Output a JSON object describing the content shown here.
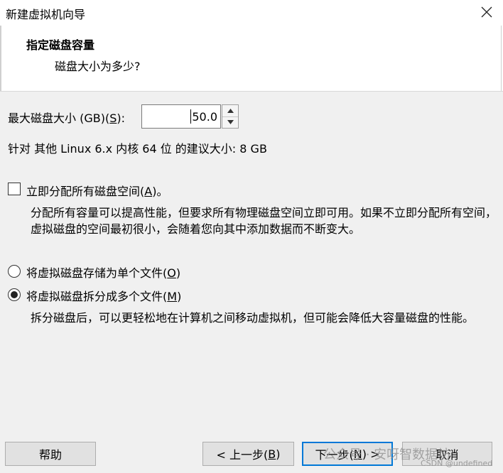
{
  "window": {
    "title": "新建虚拟机向导"
  },
  "header": {
    "title": "指定磁盘容量",
    "subtitle": "磁盘大小为多少?"
  },
  "disk_size": {
    "label_pre": "最大磁盘大小 (GB)(",
    "label_key": "S",
    "label_post": "):",
    "value": "50.0"
  },
  "recommend_text": "针对 其他 Linux 6.x 内核 64 位 的建议大小: 8 GB",
  "allocate": {
    "label_pre": "立即分配所有磁盘空间(",
    "label_key": "A",
    "label_post": ")。",
    "checked": false,
    "description": "分配所有容量可以提高性能，但要求所有物理磁盘空间立即可用。如果不立即分配所有空间，虚拟磁盘的空间最初很小，会随着您向其中添加数据而不断变大。"
  },
  "storage_options": [
    {
      "label_pre": "将虚拟磁盘存储为单个文件(",
      "label_key": "O",
      "label_post": ")",
      "selected": false
    },
    {
      "label_pre": "将虚拟磁盘拆分成多个文件(",
      "label_key": "M",
      "label_post": ")",
      "selected": true
    }
  ],
  "split_description": "拆分磁盘后，可以更轻松地在计算机之间移动虚拟机，但可能会降低大容量磁盘的性能。",
  "buttons": {
    "help": "帮助",
    "prev_pre": "< 上一步(",
    "prev_key": "B",
    "prev_post": ")",
    "next_pre": "下一步(",
    "next_key": "N",
    "next_post": ") >",
    "cancel": "取消"
  },
  "watermark": {
    "main": "公众号 · 安呀智数据坊",
    "sub": "CSDN @undefined"
  }
}
